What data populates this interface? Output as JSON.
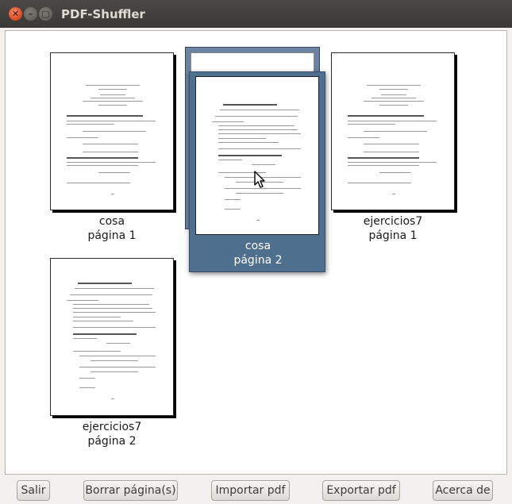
{
  "window": {
    "title": "PDF-Shuffler"
  },
  "pages": [
    {
      "file": "cosa",
      "label": "página 1",
      "selected": false
    },
    {
      "file": "cosa",
      "label": "página 2",
      "selected": true
    },
    {
      "file": "ejercicios7",
      "label": "página 1",
      "selected": false
    },
    {
      "file": "ejercicios7",
      "label": "página 2",
      "selected": false
    }
  ],
  "toolbar": {
    "quit": "Salir",
    "delete": "Borrar página(s)",
    "import": "Importar pdf",
    "export": "Exportar pdf",
    "about": "Acerca de"
  }
}
